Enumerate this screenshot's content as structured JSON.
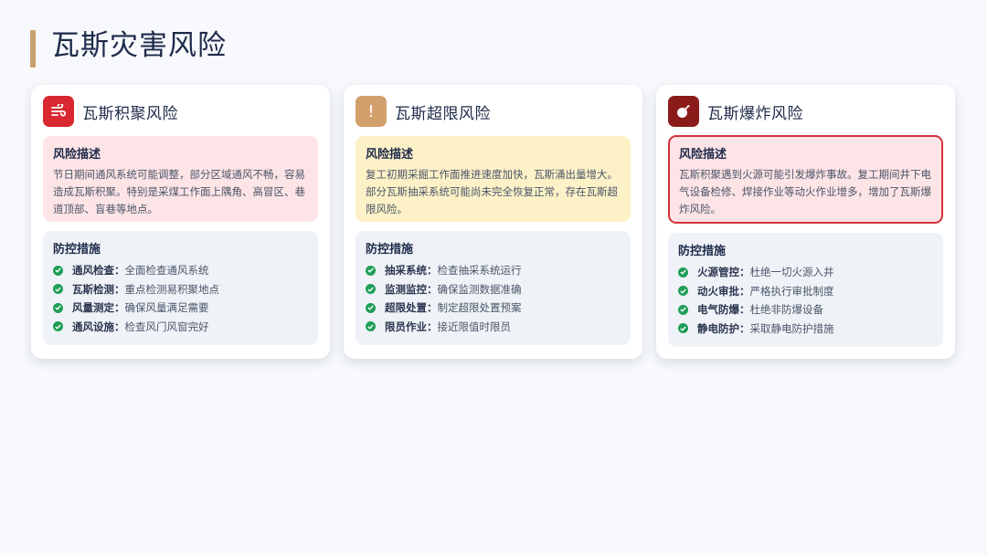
{
  "page": {
    "title": "瓦斯灾害风险"
  },
  "colors": {
    "accent_bar": "#c9a06f",
    "card1_icon": "#d9282f",
    "card2_icon": "#d1a06c",
    "card3_icon": "#8b1a1a",
    "check": "#1f9e57"
  },
  "cards": [
    {
      "title": "瓦斯积聚风险",
      "icon": "wind-icon",
      "risk_label": "风险描述",
      "risk_text": "节日期间通风系统可能调整，部分区域通风不畅，容易造成瓦斯积聚。特别是采煤工作面上隅角、高冒区、巷道顶部、盲巷等地点。",
      "measures_label": "防控措施",
      "measures": [
        {
          "key": "通风检查：",
          "value": "全面检查通风系统"
        },
        {
          "key": "瓦斯检测：",
          "value": "重点检测易积聚地点"
        },
        {
          "key": "风量测定：",
          "value": "确保风量满足需要"
        },
        {
          "key": "通风设施：",
          "value": "检查风门风窗完好"
        }
      ]
    },
    {
      "title": "瓦斯超限风险",
      "icon": "exclamation-icon",
      "icon_glyph": "!",
      "risk_label": "风险描述",
      "risk_text": "复工初期采掘工作面推进速度加快，瓦斯涌出量增大。部分瓦斯抽采系统可能尚未完全恢复正常，存在瓦斯超限风险。",
      "measures_label": "防控措施",
      "measures": [
        {
          "key": "抽采系统：",
          "value": "检查抽采系统运行"
        },
        {
          "key": "监测监控：",
          "value": "确保监测数据准确"
        },
        {
          "key": "超限处置：",
          "value": "制定超限处置预案"
        },
        {
          "key": "限员作业：",
          "value": "接近限值时限员"
        }
      ]
    },
    {
      "title": "瓦斯爆炸风险",
      "icon": "bomb-icon",
      "risk_label": "风险描述",
      "risk_text": "瓦斯积聚遇到火源可能引发爆炸事故。复工期间井下电气设备检修、焊接作业等动火作业增多，增加了瓦斯爆炸风险。",
      "measures_label": "防控措施",
      "measures": [
        {
          "key": "火源管控：",
          "value": "杜绝一切火源入井"
        },
        {
          "key": "动火审批：",
          "value": "严格执行审批制度"
        },
        {
          "key": "电气防爆：",
          "value": "杜绝非防爆设备"
        },
        {
          "key": "静电防护：",
          "value": "采取静电防护措施"
        }
      ]
    }
  ]
}
